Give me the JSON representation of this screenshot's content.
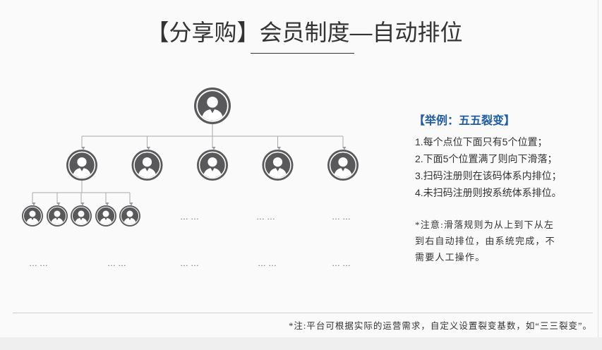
{
  "title": "【分享购】会员制度—自动排位",
  "diagram": {
    "ellipsis": "……"
  },
  "example": {
    "heading": "【举例：五五裂变】",
    "rules": [
      "1.每个点位下面只有5个位置；",
      "2.下面5个位置满了则向下滑落；",
      "3.扫码注册则在该码体系内排位；",
      "4.未扫码注册则按系统体系排位。"
    ],
    "note_lines": [
      "*注意:滑落规则为从上到下从左",
      "到右自动排位，由系统完成，不",
      "需要人工操作。"
    ]
  },
  "footer": {
    "note": "*注:平台可根据实际的运营需求，自定义设置裂变基数，如“三三裂变”。"
  },
  "colors": {
    "heading_blue": "#1f5ca6",
    "avatar_gray": "#59595b",
    "connector_gray": "#aaaaaa"
  },
  "icons": {
    "member": "person-icon"
  }
}
